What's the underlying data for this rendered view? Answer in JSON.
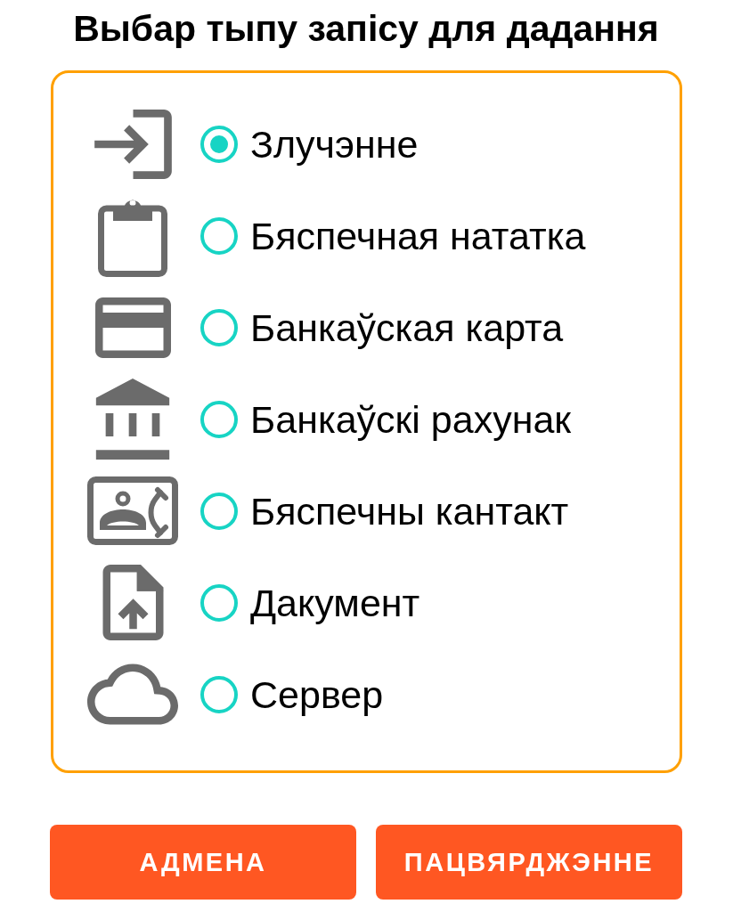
{
  "dialog": {
    "title": "Выбар тыпу запісу для дадання"
  },
  "options": [
    {
      "kind": "login",
      "label": "Злучэнне",
      "selected": true
    },
    {
      "kind": "clipboard",
      "label": "Бяспечная нататка",
      "selected": false
    },
    {
      "kind": "card",
      "label": "Банкаўская карта",
      "selected": false
    },
    {
      "kind": "bank",
      "label": "Банкаўскі рахунак",
      "selected": false
    },
    {
      "kind": "contact",
      "label": "Бяспечны кантакт",
      "selected": false
    },
    {
      "kind": "upload",
      "label": "Дакумент",
      "selected": false
    },
    {
      "kind": "cloud",
      "label": "Сервер",
      "selected": false
    }
  ],
  "buttons": [
    {
      "label": "АДМЕНА"
    },
    {
      "label": "ПАЦВЯРДЖЭННЕ"
    }
  ]
}
